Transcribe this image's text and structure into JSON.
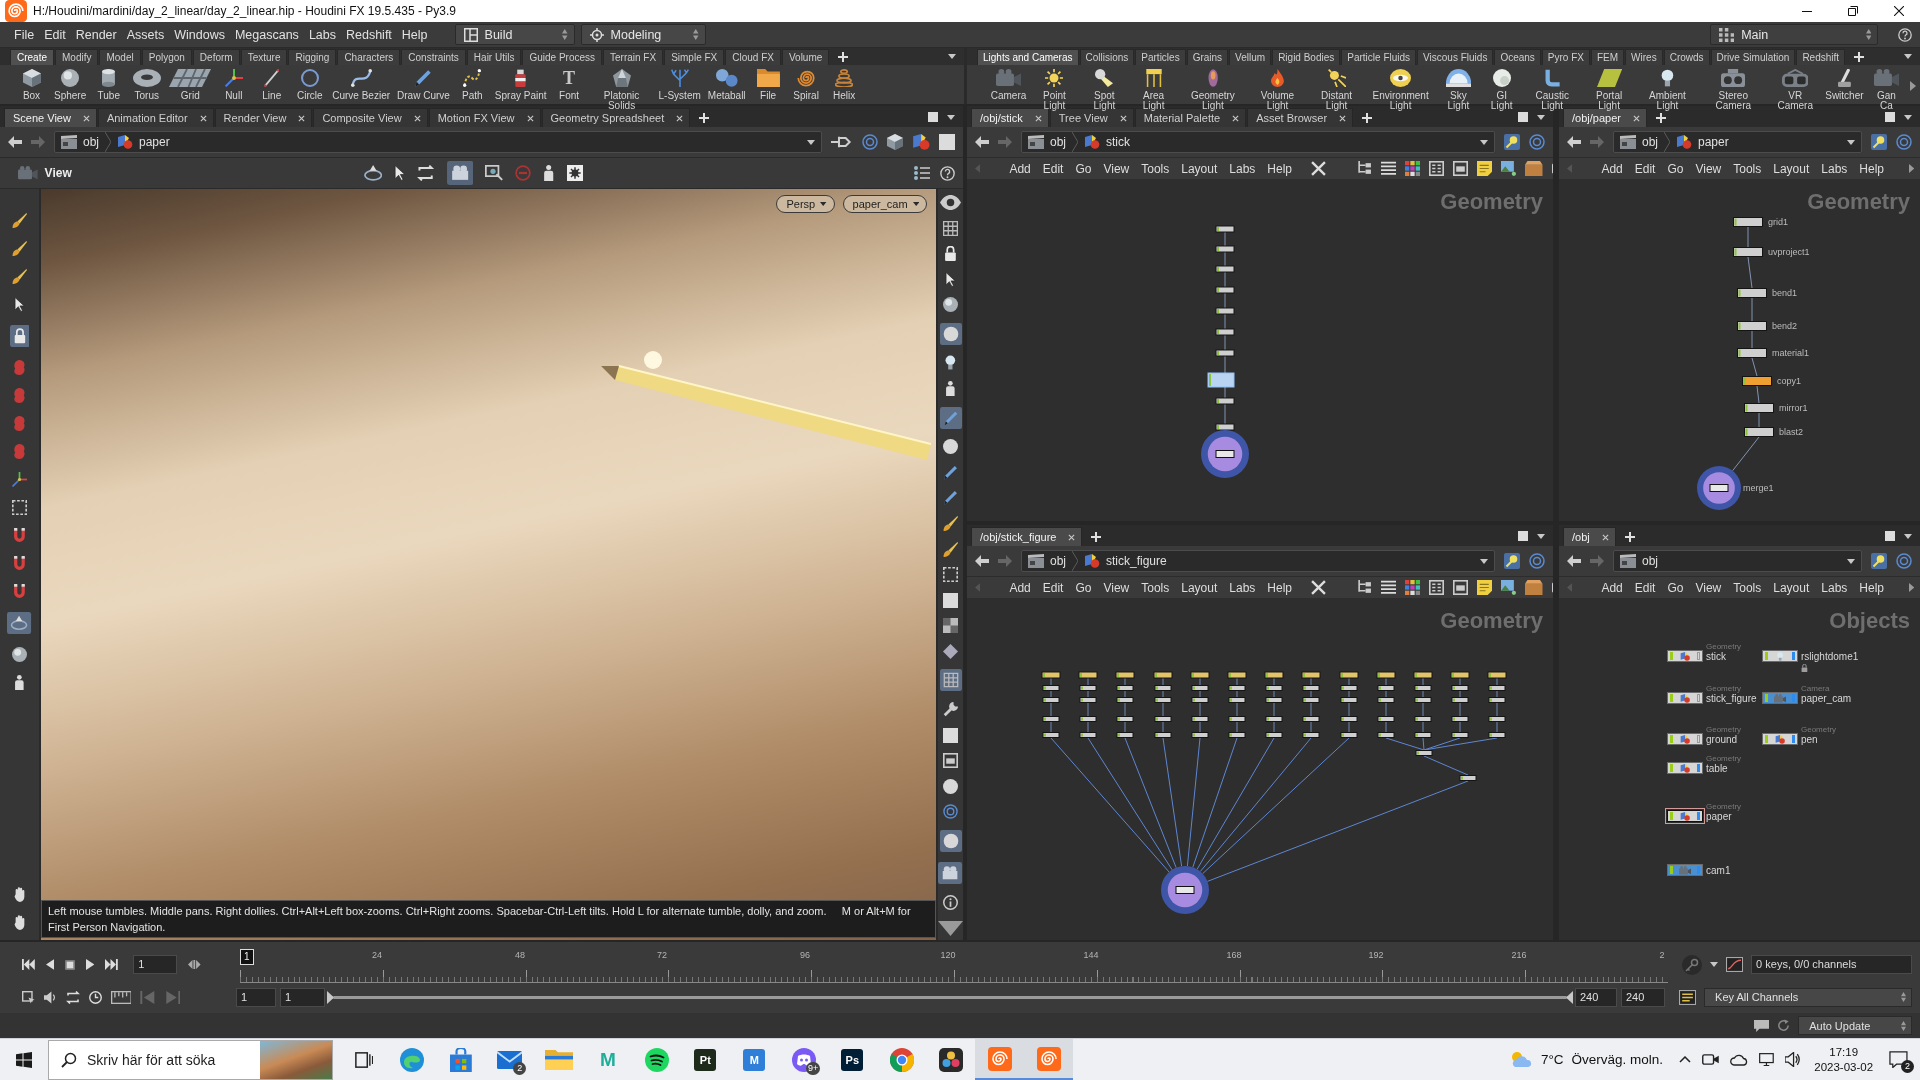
{
  "window": {
    "title": "H:/Houdini/mardini/day_2_linear/day_2_linear.hip - Houdini FX 19.5.435 - Py3.9"
  },
  "menu_bar": {
    "items": [
      "File",
      "Edit",
      "Render",
      "Assets",
      "Windows",
      "Megascans",
      "Labs",
      "Redshift",
      "Help"
    ],
    "desktop": "Build",
    "context": "Modeling",
    "workspace": "Main"
  },
  "shelves": [
    {
      "tabs": [
        {
          "label": "Create",
          "selected": true
        },
        {
          "label": "Modify",
          "selected": false
        },
        {
          "label": "Model",
          "selected": false
        },
        {
          "label": "Polygon",
          "selected": false
        },
        {
          "label": "Deform",
          "selected": false
        },
        {
          "label": "Texture",
          "selected": false
        },
        {
          "label": "Rigging",
          "selected": false
        },
        {
          "label": "Characters",
          "selected": false
        },
        {
          "label": "Constraints",
          "selected": false
        },
        {
          "label": "Hair Utils",
          "selected": false
        },
        {
          "label": "Guide Process",
          "selected": false
        },
        {
          "label": "Terrain FX",
          "selected": false
        },
        {
          "label": "Simple FX",
          "selected": false
        },
        {
          "label": "Cloud FX",
          "selected": false
        },
        {
          "label": "Volume",
          "selected": false
        }
      ],
      "tools": [
        {
          "label": "Box"
        },
        {
          "label": "Sphere"
        },
        {
          "label": "Tube"
        },
        {
          "label": "Torus"
        },
        {
          "label": "Grid"
        },
        {
          "label": "Null"
        },
        {
          "label": "Line"
        },
        {
          "label": "Circle"
        },
        {
          "label": "Curve Bezier"
        },
        {
          "label": "Draw Curve"
        },
        {
          "label": "Path"
        },
        {
          "label": "Spray Paint"
        },
        {
          "label": "Font",
          "glyph": "T"
        },
        {
          "label": "Platonic Solids"
        },
        {
          "label": "L-System"
        },
        {
          "label": "Metaball"
        },
        {
          "label": "File"
        },
        {
          "label": "Spiral"
        },
        {
          "label": "Helix"
        }
      ]
    },
    {
      "tabs": [
        {
          "label": "Lights and Cameras",
          "selected": true
        },
        {
          "label": "Collisions",
          "selected": false
        },
        {
          "label": "Particles",
          "selected": false
        },
        {
          "label": "Grains",
          "selected": false
        },
        {
          "label": "Vellum",
          "selected": false
        },
        {
          "label": "Rigid Bodies",
          "selected": false
        },
        {
          "label": "Particle Fluids",
          "selected": false
        },
        {
          "label": "Viscous Fluids",
          "selected": false
        },
        {
          "label": "Oceans",
          "selected": false
        },
        {
          "label": "Pyro FX",
          "selected": false
        },
        {
          "label": "FEM",
          "selected": false
        },
        {
          "label": "Wires",
          "selected": false
        },
        {
          "label": "Crowds",
          "selected": false
        },
        {
          "label": "Drive Simulation",
          "selected": false
        },
        {
          "label": "Redshift",
          "selected": false
        }
      ],
      "tools": [
        {
          "label": "Camera"
        },
        {
          "label": "Point Light"
        },
        {
          "label": "Spot Light"
        },
        {
          "label": "Area Light"
        },
        {
          "label": "Geometry Light"
        },
        {
          "label": "Volume Light"
        },
        {
          "label": "Distant Light"
        },
        {
          "label": "Environment Light"
        },
        {
          "label": "Sky Light"
        },
        {
          "label": "GI Light"
        },
        {
          "label": "Caustic Light"
        },
        {
          "label": "Portal Light"
        },
        {
          "label": "Ambient Light"
        },
        {
          "label": "Stereo Camera"
        },
        {
          "label": "VR Camera"
        },
        {
          "label": "Switcher"
        },
        {
          "label": "Gan Ca"
        }
      ]
    }
  ],
  "scene_pane": {
    "tabs": [
      {
        "label": "Scene View",
        "selected": true
      },
      {
        "label": "Animation Editor",
        "selected": false
      },
      {
        "label": "Render View",
        "selected": false
      },
      {
        "label": "Composite View",
        "selected": false
      },
      {
        "label": "Motion FX View",
        "selected": false
      },
      {
        "label": "Geometry Spreadsheet",
        "selected": false
      }
    ],
    "path": [
      "obj",
      "paper"
    ],
    "viewer_label": "View",
    "view_tools": [
      {
        "selected": false
      },
      {
        "selected": false
      },
      {
        "selected": false
      },
      {
        "selected": true
      },
      {
        "selected": false
      },
      {
        "selected": false
      },
      {
        "selected": false
      },
      {
        "selected": false
      }
    ],
    "left_tools": [
      {
        "selected": false
      },
      {
        "selected": false
      },
      {
        "selected": false
      },
      {
        "selected": false
      },
      {
        "selected": true
      },
      {
        "selected": false
      },
      {
        "selected": false
      },
      {
        "selected": false
      },
      {
        "selected": false
      },
      {
        "selected": false
      },
      {
        "selected": false
      },
      {
        "selected": false
      },
      {
        "selected": false
      },
      {
        "selected": false
      },
      {
        "selected": true
      },
      {
        "selected": false
      },
      {
        "selected": false
      },
      {
        "selected": false
      },
      {
        "selected": false
      }
    ],
    "right_tools": [
      {
        "selected": false
      },
      {
        "selected": false
      },
      {
        "selected": false
      },
      {
        "selected": false
      },
      {
        "selected": false
      },
      {
        "selected": true
      },
      {
        "selected": false
      },
      {
        "selected": false
      },
      {
        "selected": true
      },
      {
        "selected": false
      },
      {
        "selected": false
      },
      {
        "selected": false
      },
      {
        "selected": false
      },
      {
        "selected": false
      },
      {
        "selected": false
      },
      {
        "selected": false
      },
      {
        "selected": false
      },
      {
        "selected": false
      },
      {
        "selected": true
      },
      {
        "selected": false
      },
      {
        "selected": false
      },
      {
        "selected": false
      },
      {
        "selected": false
      },
      {
        "selected": false
      },
      {
        "selected": true
      },
      {
        "selected": true
      },
      {
        "selected": false
      },
      {
        "selected": false
      }
    ],
    "projection": "Persp",
    "camera": "paper_cam",
    "hint": "Left mouse tumbles. Middle pans. Right dollies. Ctrl+Alt+Left box-zooms. Ctrl+Right zooms. Spacebar-Ctrl-Left tilts. Hold L for alternate tumble, dolly, and zoom.     M or Alt+M for First Person Navigation."
  },
  "network_panes": [
    {
      "tabs": [
        {
          "label": "/obj/stick",
          "selected": true
        },
        {
          "label": "Tree View",
          "selected": false
        },
        {
          "label": "Material Palette",
          "selected": false
        },
        {
          "label": "Asset Browser",
          "selected": false
        }
      ],
      "path": [
        "obj",
        "stick"
      ],
      "menu": [
        "Add",
        "Edit",
        "Go",
        "View",
        "Tools",
        "Layout",
        "Labs",
        "Help"
      ],
      "context_label": "Geometry",
      "graph": {
        "kind": "chain"
      }
    },
    {
      "tabs": [
        {
          "label": "/obj/paper",
          "selected": true
        }
      ],
      "path": [
        "obj",
        "paper"
      ],
      "menu": [
        "Add",
        "Edit",
        "Go",
        "View",
        "Tools",
        "Layout",
        "Labs",
        "Help"
      ],
      "context_label": "Geometry",
      "graph": {
        "kind": "branch",
        "nodes": [
          {
            "name": "grid1",
            "color": "#cfcfcf"
          },
          {
            "name": "uvproject1",
            "color": "#cfcfcf"
          },
          {
            "name": "bend1",
            "color": "#cfcfcf"
          },
          {
            "name": "bend2",
            "color": "#cfcfcf"
          },
          {
            "name": "material1",
            "color": "#cfcfcf"
          },
          {
            "name": "copy1",
            "color": "#f0a030"
          },
          {
            "name": "mirror1",
            "color": "#cfcfcf"
          },
          {
            "name": "blast2",
            "color": "#cfcfcf"
          }
        ],
        "output": "merge1"
      }
    },
    {
      "tabs": [
        {
          "label": "/obj/stick_figure",
          "selected": true
        }
      ],
      "path": [
        "obj",
        "stick_figure"
      ],
      "menu": [
        "Add",
        "Edit",
        "Go",
        "View",
        "Tools",
        "Layout",
        "Labs",
        "Help"
      ],
      "context_label": "Geometry",
      "graph": {
        "kind": "fan"
      }
    },
    {
      "tabs": [
        {
          "label": "/obj",
          "selected": true
        }
      ],
      "path": [
        "obj"
      ],
      "menu": [
        "Add",
        "Edit",
        "Go",
        "View",
        "Tools",
        "Layout",
        "Labs",
        "Help"
      ],
      "context_label": "Objects",
      "graph": {
        "kind": "objects",
        "nodes": [
          {
            "type_label": "Geometry",
            "name": "stick",
            "kind": "geometry",
            "display": false,
            "selected": false,
            "locked": false
          },
          {
            "name": "rslightdome1",
            "kind": "light",
            "display": true,
            "selected": false,
            "locked": true
          },
          {
            "type_label": "Geometry",
            "name": "stick_figure",
            "kind": "geometry",
            "display": false,
            "selected": false,
            "locked": false
          },
          {
            "type_label": "Camera",
            "name": "paper_cam",
            "kind": "camera",
            "display": true,
            "selected": false,
            "locked": false
          },
          {
            "type_label": "Geometry",
            "name": "ground",
            "kind": "geometry",
            "display": false,
            "selected": false,
            "locked": false
          },
          {
            "type_label": "Geometry",
            "name": "pen",
            "kind": "geometry",
            "display": true,
            "selected": false,
            "locked": false
          },
          {
            "type_label": "Geometry",
            "name": "table",
            "kind": "geometry",
            "display": true,
            "selected": false,
            "locked": false
          },
          {
            "type_label": "Geometry",
            "name": "paper",
            "kind": "geometry",
            "display": true,
            "selected": true,
            "locked": false
          },
          {
            "name": "cam1",
            "kind": "camera",
            "display": true,
            "selected": false,
            "locked": false
          }
        ]
      }
    }
  ],
  "timeline": {
    "frame": "1",
    "stopped": true,
    "slider": {
      "marker": "1",
      "level": 0,
      "ticks": [
        "24",
        "48",
        "72",
        "96",
        "120",
        "144",
        "168",
        "192",
        "216",
        "2"
      ]
    },
    "range": {
      "start": "1",
      "playback_start": "1",
      "level": 1,
      "playback_end": "240",
      "end": "240"
    },
    "keys_info": "0 keys, 0/0 channels",
    "key_mode": "Key All Channels"
  },
  "status_bar": {
    "update_mode": "Auto Update"
  },
  "taskbar": {
    "search": {
      "placeholder": "Skriv här för att söka"
    },
    "apps": [
      {
        "kind": "wave",
        "active": false
      },
      {
        "kind": "bag",
        "active": false
      },
      {
        "kind": "envelope",
        "badge": "2",
        "active": false
      },
      {
        "kind": "folder",
        "active": false
      },
      {
        "kind": "letter",
        "glyph": "M",
        "color": "#1fae9a",
        "active": false
      },
      {
        "kind": "rings",
        "active": false
      },
      {
        "kind": "tile",
        "glyph": "Pt",
        "color": "#1e2a1a",
        "active": false
      },
      {
        "kind": "tile",
        "glyph": "M",
        "color": "#2f7fd8",
        "active": false
      },
      {
        "kind": "chat",
        "badge": "9+",
        "active": false
      },
      {
        "kind": "tile",
        "glyph": "Ps",
        "color": "#001e36",
        "active": false
      },
      {
        "kind": "wheel",
        "active": false
      },
      {
        "kind": "petals",
        "active": false
      },
      {
        "kind": "swirl",
        "active": true
      },
      {
        "kind": "swirl",
        "active": true
      }
    ],
    "weather": {
      "temperature": "7°C",
      "condition": "Överväg. moln."
    },
    "clock": {
      "time": "17:19",
      "date": "2023-03-02"
    },
    "notifications": "2"
  }
}
